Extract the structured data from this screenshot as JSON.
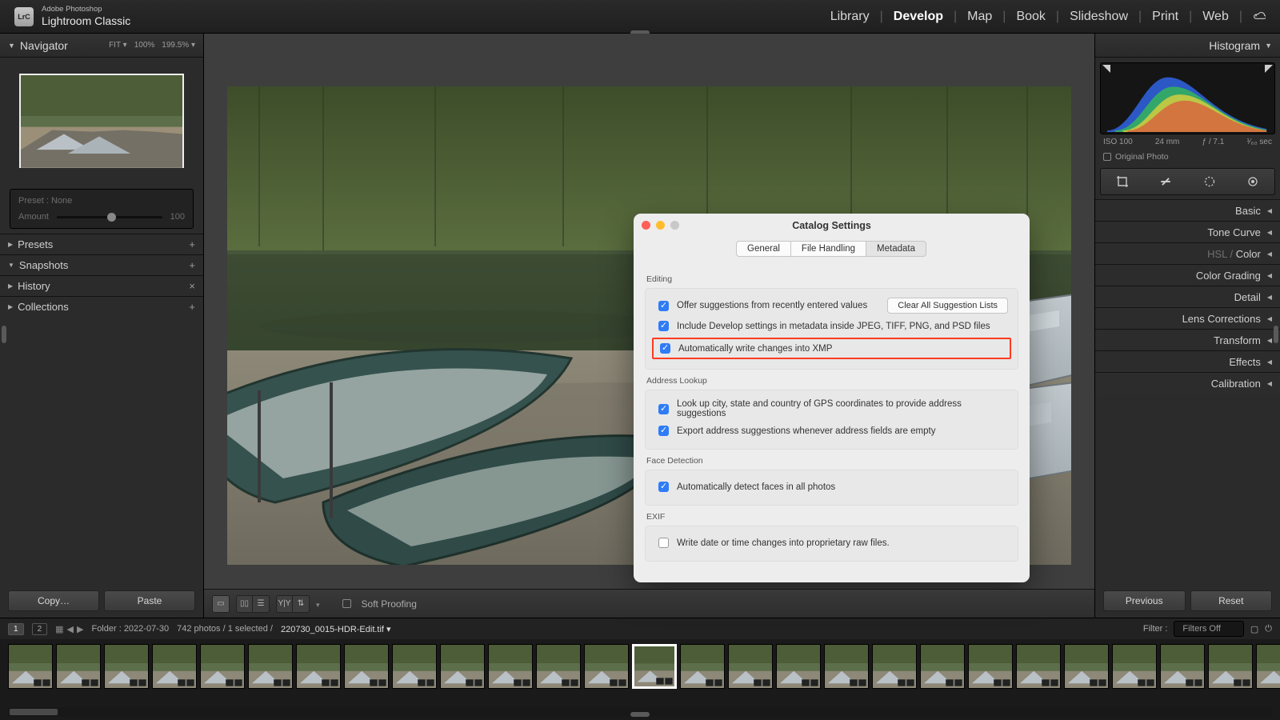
{
  "brand": {
    "line1": "Adobe Photoshop",
    "line2": "Lightroom Classic",
    "logo": "LrC"
  },
  "modules": {
    "items": [
      "Library",
      "Develop",
      "Map",
      "Book",
      "Slideshow",
      "Print",
      "Web"
    ],
    "active": "Develop"
  },
  "left": {
    "navigator": {
      "title": "Navigator",
      "zoom": [
        "FIT ▾",
        "100%",
        "199.5% ▾"
      ]
    },
    "preset_box": {
      "label": "Preset : None",
      "amount_label": "Amount",
      "amount_value": "100"
    },
    "sections": {
      "presets": "Presets",
      "snapshots": "Snapshots",
      "history": "History",
      "collections": "Collections"
    },
    "buttons": {
      "copy": "Copy…",
      "paste": "Paste"
    }
  },
  "canvas_bar": {
    "soft_proofing": "Soft Proofing"
  },
  "right": {
    "histogram_title": "Histogram",
    "meta": {
      "iso": "ISO 100",
      "focal": "24 mm",
      "aperture": "ƒ / 7.1",
      "shutter": "¹⁄₆₀ sec"
    },
    "orig": "Original Photo",
    "panels": [
      "Basic",
      "Tone Curve",
      "HSL / Color",
      "Color Grading",
      "Detail",
      "Lens Corrections",
      "Transform",
      "Effects",
      "Calibration"
    ],
    "buttons": {
      "prev": "Previous",
      "reset": "Reset"
    }
  },
  "dialog": {
    "title": "Catalog Settings",
    "tabs": [
      "General",
      "File Handling",
      "Metadata"
    ],
    "active_tab": "Metadata",
    "groups": {
      "editing": {
        "label": "Editing",
        "opt1": "Offer suggestions from recently entered values",
        "btn": "Clear All Suggestion Lists",
        "opt2": "Include Develop settings in metadata inside JPEG, TIFF, PNG, and PSD files",
        "opt3": "Automatically write changes into XMP"
      },
      "address": {
        "label": "Address Lookup",
        "opt1": "Look up city, state and country of GPS coordinates to provide address suggestions",
        "opt2": "Export address suggestions whenever address fields are empty"
      },
      "face": {
        "label": "Face Detection",
        "opt1": "Automatically detect faces in all photos"
      },
      "exif": {
        "label": "EXIF",
        "opt1": "Write date or time changes into proprietary raw files."
      }
    }
  },
  "filmstrip": {
    "pages": [
      "1",
      "2"
    ],
    "folder": "Folder : 2022-07-30",
    "count": "742 photos / 1 selected /",
    "filename": "220730_0015-HDR-Edit.tif ▾",
    "filters_label": "Filter :",
    "filters_value": "Filters Off",
    "selected_index": 13,
    "thumb_count": 28
  }
}
